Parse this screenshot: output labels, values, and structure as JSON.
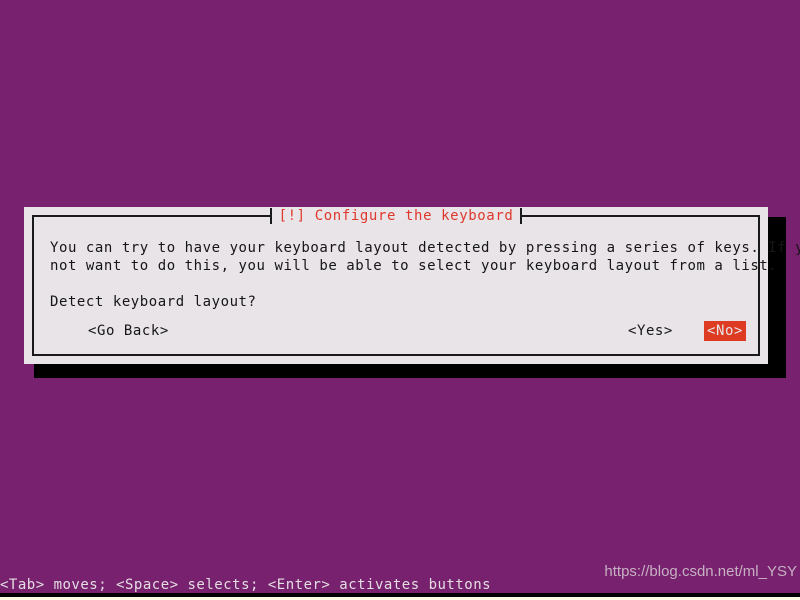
{
  "screen": {
    "background_color": "#77216F",
    "bottom_strip_color": "#000000",
    "bottom_accent_color": "#FFFFE8"
  },
  "dialog": {
    "title": "[!] Configure the keyboard",
    "title_color": "#DF382C",
    "background_color": "#E8E4E7",
    "border_color": "#1A1A1A",
    "body": {
      "paragraph1_line1": "You can try to have your keyboard layout detected by pressing a series of keys. If you do",
      "paragraph1_line2": "not want to do this, you will be able to select your keyboard layout from a list.",
      "question": "Detect keyboard layout?"
    },
    "buttons": {
      "go_back": "<Go Back>",
      "yes": "<Yes>",
      "no": "<No>",
      "selected": "<No>",
      "selected_background_color": "#DD3B22",
      "selected_text_color": "#E8E4E7"
    }
  },
  "status_bar": {
    "hint": "<Tab> moves; <Space> selects; <Enter> activates buttons",
    "watermark": "https://blog.csdn.net/ml_YSY"
  }
}
